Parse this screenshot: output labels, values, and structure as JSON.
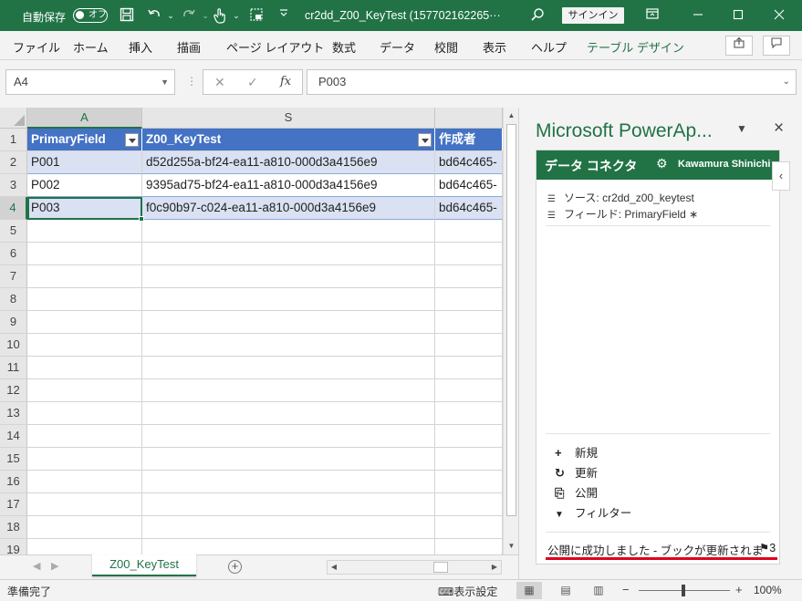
{
  "titlebar": {
    "autosave_label": "自動保存",
    "autosave_toggle": "オフ",
    "doc_title": "cr2dd_Z00_KeyTest (157702162265···",
    "signin_label": "サインイン",
    "icons": [
      "save-icon",
      "undo-icon",
      "redo-icon",
      "touch-mode-icon",
      "screenshot-icon",
      "customize-icon",
      "search-icon",
      "ribbon-display-icon",
      "minimize-icon",
      "maximize-icon",
      "close-icon"
    ]
  },
  "ribbon": {
    "tabs": [
      "ファイル",
      "ホーム",
      "挿入",
      "描画",
      "ページ レイアウト",
      "数式",
      "データ",
      "校閲",
      "表示",
      "ヘルプ",
      "テーブル デザイン"
    ],
    "active_tab": "テーブル デザイン",
    "accent_color": "#217346"
  },
  "formula_bar": {
    "name_box": "A4",
    "formula": "P003",
    "cancel_glyph": "✕",
    "enter_glyph": "✓",
    "fx_label": "fx"
  },
  "grid": {
    "columns": [
      "A",
      "S"
    ],
    "selected_column": "A",
    "rows": [
      "1",
      "2",
      "3",
      "4",
      "5",
      "6",
      "7",
      "8",
      "9",
      "10",
      "11",
      "12",
      "13",
      "14",
      "15",
      "16",
      "17",
      "18",
      "19"
    ],
    "selected_row": "4",
    "header_row": [
      "PrimaryField",
      "Z00_KeyTest",
      "作成者"
    ],
    "data_rows": [
      [
        "P001",
        "d52d255a-bf24-ea11-a810-000d3a4156e9",
        "bd64c465-"
      ],
      [
        "P002",
        "9395ad75-bf24-ea11-a810-000d3a4156e9",
        "bd64c465-"
      ],
      [
        "P003",
        "f0c90b97-c024-ea11-a810-000d3a4156e9",
        "bd64c465-"
      ]
    ],
    "table_header_color": "#4472c4",
    "table_band_color": "#d9e1f2"
  },
  "sheet_tabs": {
    "tabs": [
      "Z00_KeyTest"
    ],
    "active": "Z00_KeyTest"
  },
  "panel": {
    "title": "Microsoft PowerAp...",
    "header_title": "データ コネクタ",
    "user": "Kawamura Shinichi",
    "source": "ソース: cr2dd_z00_keytest",
    "field": "フィールド: PrimaryField ∗",
    "actions": [
      {
        "icon": "plus-icon",
        "glyph": "+",
        "label": "新規"
      },
      {
        "icon": "refresh-icon",
        "glyph": "↻",
        "label": "更新"
      },
      {
        "icon": "publish-icon",
        "glyph": "⎘",
        "label": "公開"
      },
      {
        "icon": "filter-icon",
        "glyph": "▼",
        "label": "フィルター"
      }
    ],
    "status_message": "公開に成功しました - ブックが更新されま",
    "status_count": "3",
    "status_underline_color": "#e0001b"
  },
  "statusbar": {
    "ready": "準備完了",
    "display_settings": "表示設定",
    "zoom": "100%"
  }
}
